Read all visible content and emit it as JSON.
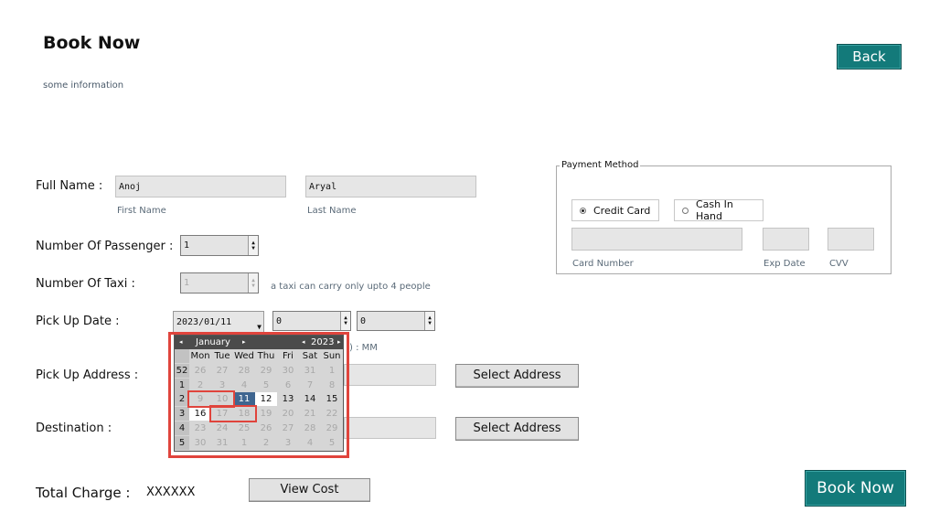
{
  "header": {
    "title": "Book Now",
    "subtitle": "some information",
    "back_label": "Back"
  },
  "form": {
    "full_name_label": "Full Name :",
    "first_name_value": "Anoj",
    "first_name_hint": "First Name",
    "last_name_value": "Aryal",
    "last_name_hint": "Last Name",
    "passengers_label": "Number Of Passenger :",
    "passengers_value": "1",
    "taxi_label": "Number Of Taxi :",
    "taxi_value": "1",
    "taxi_hint": "a taxi can carry only upto 4 people",
    "pickup_date_label": "Pick Up Date :",
    "pickup_date_value": "2023/01/11",
    "hour_value": "0",
    "minute_value": "0",
    "time_hint_partial": ") : MM",
    "pickup_address_label": "Pick Up Address :",
    "select_address_label": "Select Address",
    "destination_label": "Destination :",
    "total_charge_label": "Total Charge :",
    "total_charge_value": "XXXXXX",
    "view_cost_label": "View Cost",
    "book_now_label": "Book Now"
  },
  "payment": {
    "legend": "Payment Method",
    "options": [
      {
        "label": "Credit Card",
        "selected": true
      },
      {
        "label": "Cash In Hand",
        "selected": false
      }
    ],
    "card_number_hint": "Card Number",
    "exp_date_hint": "Exp Date",
    "cvv_hint": "CVV"
  },
  "calendar": {
    "month": "January",
    "year": "2023",
    "days_of_week": [
      "Mon",
      "Tue",
      "Wed",
      "Thu",
      "Fri",
      "Sat",
      "Sun"
    ],
    "weeks": [
      {
        "week": "52",
        "days": [
          "26",
          "27",
          "28",
          "29",
          "30",
          "31",
          "1"
        ],
        "current": [
          false,
          false,
          false,
          false,
          false,
          false,
          false
        ]
      },
      {
        "week": "1",
        "days": [
          "2",
          "3",
          "4",
          "5",
          "6",
          "7",
          "8"
        ],
        "current": [
          false,
          false,
          false,
          false,
          false,
          false,
          false
        ]
      },
      {
        "week": "2",
        "days": [
          "9",
          "10",
          "11",
          "12",
          "13",
          "14",
          "15"
        ],
        "current": [
          false,
          false,
          true,
          true,
          true,
          true,
          true
        ]
      },
      {
        "week": "3",
        "days": [
          "16",
          "17",
          "18",
          "19",
          "20",
          "21",
          "22"
        ],
        "current": [
          true,
          false,
          false,
          false,
          false,
          false,
          false
        ]
      },
      {
        "week": "4",
        "days": [
          "23",
          "24",
          "25",
          "26",
          "27",
          "28",
          "29"
        ],
        "current": [
          false,
          false,
          false,
          false,
          false,
          false,
          false
        ]
      },
      {
        "week": "5",
        "days": [
          "30",
          "31",
          "1",
          "2",
          "3",
          "4",
          "5"
        ],
        "current": [
          false,
          false,
          false,
          false,
          false,
          false,
          false
        ]
      }
    ],
    "selected_day": "11",
    "colors": {
      "selected": "#3f6690",
      "highlight": "#e0443c"
    }
  },
  "colors": {
    "accent": "#137a7a"
  }
}
